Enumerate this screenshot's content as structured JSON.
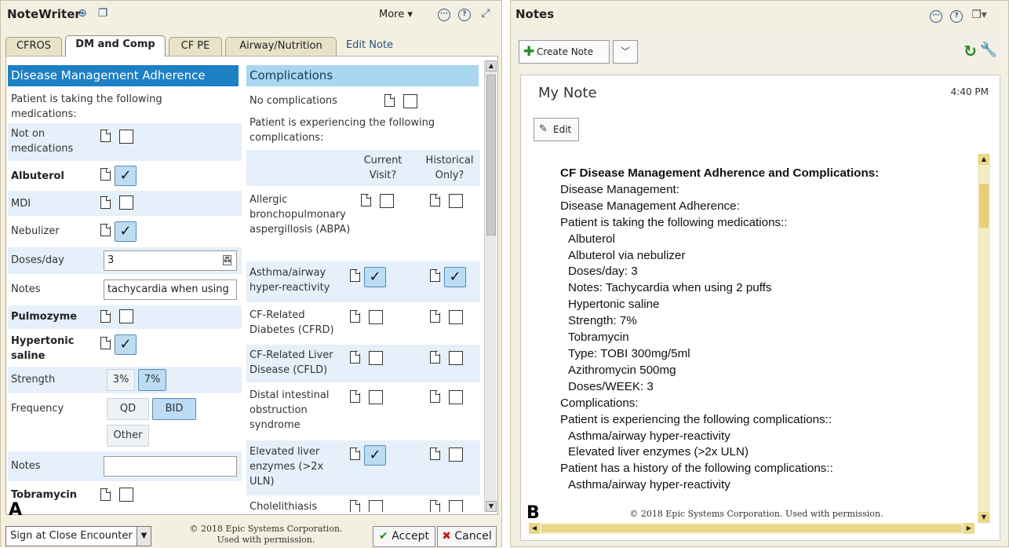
{
  "panelA": {
    "letter": "A",
    "app_title": "NoteWriter",
    "more_label": "More ▾",
    "tabs": [
      "CFROS",
      "DM and Comp",
      "CF PE",
      "Airway/Nutrition",
      "Edit Note"
    ],
    "dm": {
      "header": "Disease Management Adherence",
      "intro": "Patient is taking the following medications:",
      "not_on_meds": "Not on medications",
      "albuterol": "Albuterol",
      "mdi": "MDI",
      "nebulizer": "Nebulizer",
      "doses_label": "Doses/day",
      "doses_value": "3",
      "notes_label": "Notes",
      "notes_value": "tachycardia when using",
      "pulmozyme": "Pulmozyme",
      "hypertonic": "Hypertonic saline",
      "strength_label": "Strength",
      "strength_opts": [
        "3%",
        "7%"
      ],
      "frequency_label": "Frequency",
      "freq_opts": [
        "QD",
        "BID",
        "Other"
      ],
      "notes2_label": "Notes",
      "notes2_value": "",
      "tobramycin": "Tobramycin"
    },
    "comp": {
      "header": "Complications",
      "none": "No complications",
      "intro": "Patient is experiencing the following complications:",
      "col_current": "Current Visit?",
      "col_historical": "Historical Only?",
      "items": [
        "Allergic bronchopulmonary aspergillosis (ABPA)",
        "Asthma/airway hyper-reactivity",
        "CF-Related Diabetes (CFRD)",
        "CF-Related Liver Disease (CFLD)",
        "Distal intestinal obstruction syndrome",
        "Elevated liver enzymes (>2x ULN)",
        "Cholelithiasis"
      ]
    },
    "footer": {
      "sign_select": "Sign at Close Encounter",
      "copyright_1": "© 2018 Epic Systems Corporation.",
      "copyright_2": "Used with permission.",
      "accept": "Accept",
      "cancel": "Cancel"
    }
  },
  "panelB": {
    "letter": "B",
    "title": "Notes",
    "create_note": "Create Note",
    "note_title": "My Note",
    "note_time": "4:40 PM",
    "edit_label": "Edit",
    "copyright": "© 2018 Epic Systems Corporation. Used with permission.",
    "note_lines": [
      {
        "text": "CF Disease Management Adherence and Complications:",
        "bold": true,
        "indent": false
      },
      {
        "text": "Disease Management:",
        "bold": false,
        "indent": false
      },
      {
        "text": "Disease Management Adherence:",
        "bold": false,
        "indent": false
      },
      {
        "text": "Patient is taking the following medications::",
        "bold": false,
        "indent": false
      },
      {
        "text": "Albuterol",
        "bold": false,
        "indent": true
      },
      {
        "text": "Albuterol via nebulizer",
        "bold": false,
        "indent": true
      },
      {
        "text": "Doses/day:  3",
        "bold": false,
        "indent": true
      },
      {
        "text": "Notes:  Tachycardia when using 2 puffs",
        "bold": false,
        "indent": true
      },
      {
        "text": "Hypertonic saline",
        "bold": false,
        "indent": true
      },
      {
        "text": "Strength:  7%",
        "bold": false,
        "indent": true
      },
      {
        "text": "Tobramycin",
        "bold": false,
        "indent": true
      },
      {
        "text": "Type:  TOBI 300mg/5ml",
        "bold": false,
        "indent": true
      },
      {
        "text": "Azithromycin 500mg",
        "bold": false,
        "indent": true
      },
      {
        "text": "Doses/WEEK:  3",
        "bold": false,
        "indent": true
      },
      {
        "text": "Complications:",
        "bold": false,
        "indent": false
      },
      {
        "text": "Patient is experiencing the following complications::",
        "bold": false,
        "indent": false
      },
      {
        "text": "Asthma/airway hyper-reactivity",
        "bold": false,
        "indent": true
      },
      {
        "text": "Elevated liver enzymes (>2x ULN)",
        "bold": false,
        "indent": true
      },
      {
        "text": "Patient has a history of the following complications::",
        "bold": false,
        "indent": false
      },
      {
        "text": "Asthma/airway hyper-reactivity",
        "bold": false,
        "indent": true
      }
    ]
  }
}
